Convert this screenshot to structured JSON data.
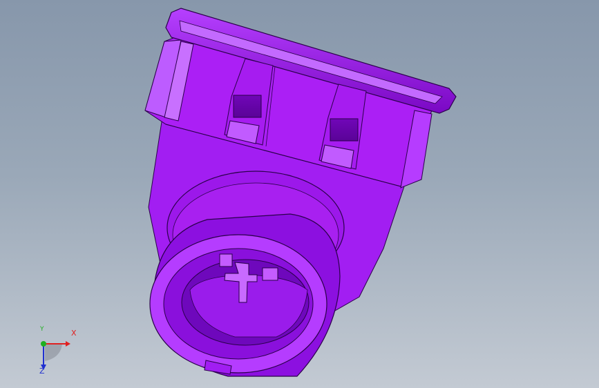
{
  "viewport": {
    "background_top": "#8797ab",
    "background_bottom": "#c3cad3",
    "model": {
      "name": "connector-housing",
      "color": "#a61cf0"
    }
  },
  "triad": {
    "x_label": "X",
    "y_label": "Y",
    "z_label": "Z",
    "x_color": "#e02020",
    "y_color": "#20b020",
    "z_color": "#2030d0"
  }
}
